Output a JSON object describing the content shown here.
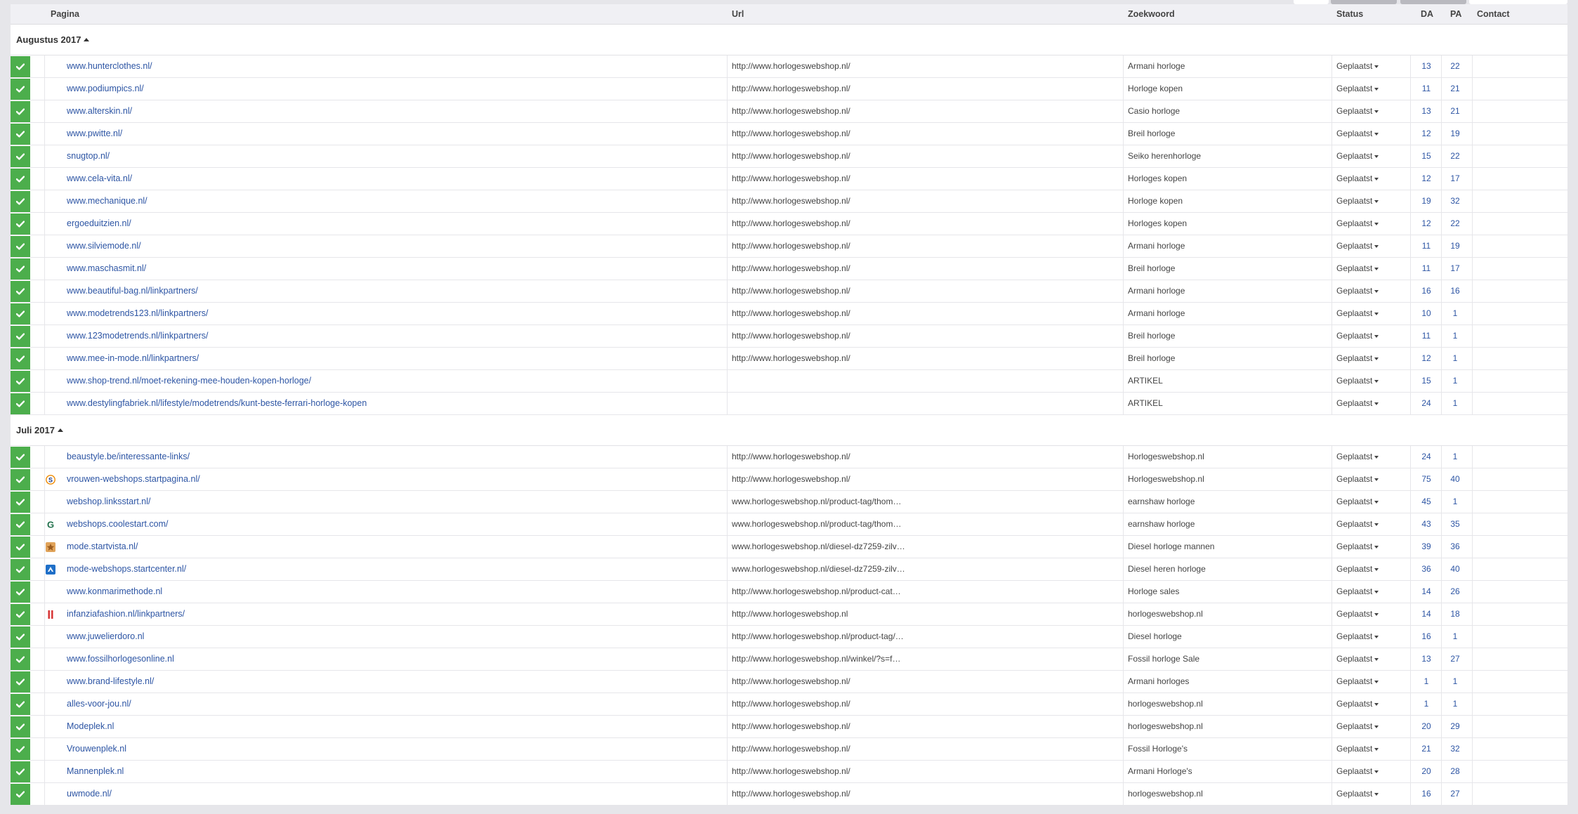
{
  "columns": {
    "page": "Pagina",
    "url": "Url",
    "keyword": "Zoekwoord",
    "status": "Status",
    "da": "DA",
    "pa": "PA",
    "contact": "Contact"
  },
  "colors": {
    "accent_green": "#4cae4c",
    "link_blue": "#2d55a4"
  },
  "groups": [
    {
      "label": "Augustus 2017",
      "rows": [
        {
          "page": "www.hunterclothes.nl/",
          "url": "http://www.horlogeswebshop.nl/",
          "keyword": "Armani horloge",
          "status": "Geplaatst",
          "da": "13",
          "pa": "22",
          "icon": ""
        },
        {
          "page": "www.podiumpics.nl/",
          "url": "http://www.horlogeswebshop.nl/",
          "keyword": "Horloge kopen",
          "status": "Geplaatst",
          "da": "11",
          "pa": "21",
          "icon": ""
        },
        {
          "page": "www.alterskin.nl/",
          "url": "http://www.horlogeswebshop.nl/",
          "keyword": "Casio horloge",
          "status": "Geplaatst",
          "da": "13",
          "pa": "21",
          "icon": ""
        },
        {
          "page": "www.pwitte.nl/",
          "url": "http://www.horlogeswebshop.nl/",
          "keyword": "Breil horloge",
          "status": "Geplaatst",
          "da": "12",
          "pa": "19",
          "icon": ""
        },
        {
          "page": "snugtop.nl/",
          "url": "http://www.horlogeswebshop.nl/",
          "keyword": "Seiko herenhorloge",
          "status": "Geplaatst",
          "da": "15",
          "pa": "22",
          "icon": ""
        },
        {
          "page": "www.cela-vita.nl/",
          "url": "http://www.horlogeswebshop.nl/",
          "keyword": "Horloges kopen",
          "status": "Geplaatst",
          "da": "12",
          "pa": "17",
          "icon": ""
        },
        {
          "page": "www.mechanique.nl/",
          "url": "http://www.horlogeswebshop.nl/",
          "keyword": "Horloge kopen",
          "status": "Geplaatst",
          "da": "19",
          "pa": "32",
          "icon": ""
        },
        {
          "page": "ergoeduitzien.nl/",
          "url": "http://www.horlogeswebshop.nl/",
          "keyword": "Horloges kopen",
          "status": "Geplaatst",
          "da": "12",
          "pa": "22",
          "icon": ""
        },
        {
          "page": "www.silviemode.nl/",
          "url": "http://www.horlogeswebshop.nl/",
          "keyword": "Armani horloge",
          "status": "Geplaatst",
          "da": "11",
          "pa": "19",
          "icon": ""
        },
        {
          "page": "www.maschasmit.nl/",
          "url": "http://www.horlogeswebshop.nl/",
          "keyword": "Breil horloge",
          "status": "Geplaatst",
          "da": "11",
          "pa": "17",
          "icon": ""
        },
        {
          "page": "www.beautiful-bag.nl/linkpartners/",
          "url": "http://www.horlogeswebshop.nl/",
          "keyword": "Armani horloge",
          "status": "Geplaatst",
          "da": "16",
          "pa": "16",
          "icon": ""
        },
        {
          "page": "www.modetrends123.nl/linkpartners/",
          "url": "http://www.horlogeswebshop.nl/",
          "keyword": "Armani horloge",
          "status": "Geplaatst",
          "da": "10",
          "pa": "1",
          "icon": ""
        },
        {
          "page": "www.123modetrends.nl/linkpartners/",
          "url": "http://www.horlogeswebshop.nl/",
          "keyword": "Breil horloge",
          "status": "Geplaatst",
          "da": "11",
          "pa": "1",
          "icon": ""
        },
        {
          "page": "www.mee-in-mode.nl/linkpartners/",
          "url": "http://www.horlogeswebshop.nl/",
          "keyword": "Breil horloge",
          "status": "Geplaatst",
          "da": "12",
          "pa": "1",
          "icon": ""
        },
        {
          "page": "www.shop-trend.nl/moet-rekening-mee-houden-kopen-horloge/",
          "url": "",
          "keyword": "ARTIKEL",
          "status": "Geplaatst",
          "da": "15",
          "pa": "1",
          "icon": ""
        },
        {
          "page": "www.destylingfabriek.nl/lifestyle/modetrends/kunt-beste-ferrari-horloge-kopen",
          "url": "",
          "keyword": "ARTIKEL",
          "status": "Geplaatst",
          "da": "24",
          "pa": "1",
          "icon": ""
        }
      ]
    },
    {
      "label": "Juli 2017",
      "rows": [
        {
          "page": "beaustyle.be/interessante-links/",
          "url": "http://www.horlogeswebshop.nl/",
          "keyword": "Horlogeswebshop.nl",
          "status": "Geplaatst",
          "da": "24",
          "pa": "1",
          "icon": ""
        },
        {
          "page": "vrouwen-webshops.startpagina.nl/",
          "url": "http://www.horlogeswebshop.nl/",
          "keyword": "Horlogeswebshop.nl",
          "status": "Geplaatst",
          "da": "75",
          "pa": "40",
          "icon": "startpagina-icon"
        },
        {
          "page": "webshop.linksstart.nl/",
          "url": "www.horlogeswebshop.nl/product-tag/thom…",
          "keyword": "earnshaw horloge",
          "status": "Geplaatst",
          "da": "45",
          "pa": "1",
          "icon": ""
        },
        {
          "page": "webshops.coolestart.com/",
          "url": "www.horlogeswebshop.nl/product-tag/thom…",
          "keyword": "earnshaw horloge",
          "status": "Geplaatst",
          "da": "43",
          "pa": "35",
          "icon": "coolestart-icon"
        },
        {
          "page": "mode.startvista.nl/",
          "url": "www.horlogeswebshop.nl/diesel-dz7259-zilv…",
          "keyword": "Diesel horloge mannen",
          "status": "Geplaatst",
          "da": "39",
          "pa": "36",
          "icon": "startvista-icon"
        },
        {
          "page": "mode-webshops.startcenter.nl/",
          "url": "www.horlogeswebshop.nl/diesel-dz7259-zilv…",
          "keyword": "Diesel heren horloge",
          "status": "Geplaatst",
          "da": "36",
          "pa": "40",
          "icon": "startcenter-icon"
        },
        {
          "page": "www.konmarimethode.nl",
          "url": "http://www.horlogeswebshop.nl/product-cat…",
          "keyword": "Horloge sales",
          "status": "Geplaatst",
          "da": "14",
          "pa": "26",
          "icon": ""
        },
        {
          "page": "infanziafashion.nl/linkpartners/",
          "url": "http://www.horlogeswebshop.nl",
          "keyword": "horlogeswebshop.nl",
          "status": "Geplaatst",
          "da": "14",
          "pa": "18",
          "icon": "infanzia-icon"
        },
        {
          "page": "www.juwelierdoro.nl",
          "url": "http://www.horlogeswebshop.nl/product-tag/…",
          "keyword": "Diesel horloge",
          "status": "Geplaatst",
          "da": "16",
          "pa": "1",
          "icon": ""
        },
        {
          "page": "www.fossilhorlogesonline.nl",
          "url": "http://www.horlogeswebshop.nl/winkel/?s=f…",
          "keyword": "Fossil horloge Sale",
          "status": "Geplaatst",
          "da": "13",
          "pa": "27",
          "icon": ""
        },
        {
          "page": "www.brand-lifestyle.nl/",
          "url": "http://www.horlogeswebshop.nl/",
          "keyword": "Armani horloges",
          "status": "Geplaatst",
          "da": "1",
          "pa": "1",
          "icon": ""
        },
        {
          "page": "alles-voor-jou.nl/",
          "url": "http://www.horlogeswebshop.nl/",
          "keyword": "horlogeswebshop.nl",
          "status": "Geplaatst",
          "da": "1",
          "pa": "1",
          "icon": ""
        },
        {
          "page": "Modeplek.nl",
          "url": "http://www.horlogeswebshop.nl/",
          "keyword": "horlogeswebshop.nl",
          "status": "Geplaatst",
          "da": "20",
          "pa": "29",
          "icon": ""
        },
        {
          "page": "Vrouwenplek.nl",
          "url": "http://www.horlogeswebshop.nl/",
          "keyword": "Fossil Horloge's",
          "status": "Geplaatst",
          "da": "21",
          "pa": "32",
          "icon": ""
        },
        {
          "page": "Mannenplek.nl",
          "url": "http://www.horlogeswebshop.nl/",
          "keyword": "Armani Horloge's",
          "status": "Geplaatst",
          "da": "20",
          "pa": "28",
          "icon": ""
        },
        {
          "page": "uwmode.nl/",
          "url": "http://www.horlogeswebshop.nl/",
          "keyword": "horlogeswebshop.nl",
          "status": "Geplaatst",
          "da": "16",
          "pa": "27",
          "icon": ""
        }
      ]
    }
  ]
}
